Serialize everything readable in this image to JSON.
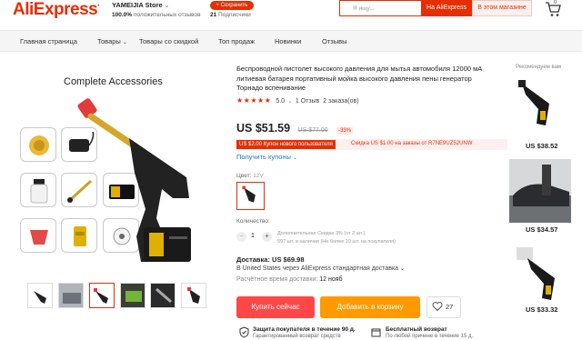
{
  "header": {
    "logo": "AliExpress",
    "store_name": "YAMEIJIA Store",
    "store_positive": "100.0%",
    "store_positive_text": "положительных отзывов",
    "save_button": "+ Сохранить",
    "subscribers_count": "21",
    "subscribers_text": "Подписчики",
    "search_placeholder": "Я ищу...",
    "search_ae": "На AliExpress",
    "search_store": "В этом магазине",
    "cart_count": "0"
  },
  "nav": {
    "items": [
      "Главная страница",
      "Товары",
      "Товары со скидкой",
      "Топ продаж",
      "Новинки",
      "Отзывы"
    ]
  },
  "gallery": {
    "main_caption": "Complete Accessories",
    "thumb_count": 6,
    "selected_thumb": 3
  },
  "product": {
    "title": "Беспроводной пистолет высокого давления для мытья автомобиля 12000 мА литиевая батарея портативный мойка высокого давления пены генератор Торнадо вспенивание",
    "rating": "5.0",
    "reviews": "1 Отзыв",
    "orders": "2 заказа(ов)",
    "price": "US $51.59",
    "old_price": "US $77.00",
    "discount": "-33%",
    "coupon_new_user": "US $2.00 Купон нового пользователя",
    "coupon_order": "Скидка US $1.00 на заказы от R7NE9UZ52UNW",
    "get_coupons": "Получить купоны",
    "color_label": "Цвет:",
    "color_value": "12V",
    "quantity_label": "Количество:",
    "quantity_value": "1",
    "quantity_note1": "Дополнительная Скидка 3% (от 2 шт.)",
    "quantity_note2": "597 шт. в наличии (Не более 10 шт. на покупателя)",
    "shipping_price": "Доставка: US $69.98",
    "shipping_method": "В United States через AliExpress стандартная доставка",
    "delivery_label": "Расчётное время доставки:",
    "delivery_date": "12 нояб",
    "buy_now": "Купить сейчас",
    "add_to_cart": "Добавить в корзину",
    "wishlist_count": "27",
    "protection_title": "Защита покупателя в течение 90 д.",
    "protection_sub": "Гарантированный возврат средств",
    "return_title": "Бесплатный возврат",
    "return_sub": "По любой причине в течение 15 д."
  },
  "recommended": {
    "title": "Рекомендуем вам",
    "items": [
      {
        "price": "US $38.52"
      },
      {
        "price": "US $34.57"
      },
      {
        "price": "US $33.32"
      }
    ]
  },
  "colors": {
    "brand": "#e62e04",
    "buy_now": "#ff4747",
    "add_to_cart": "#ff9900",
    "link": "#2176d2"
  }
}
